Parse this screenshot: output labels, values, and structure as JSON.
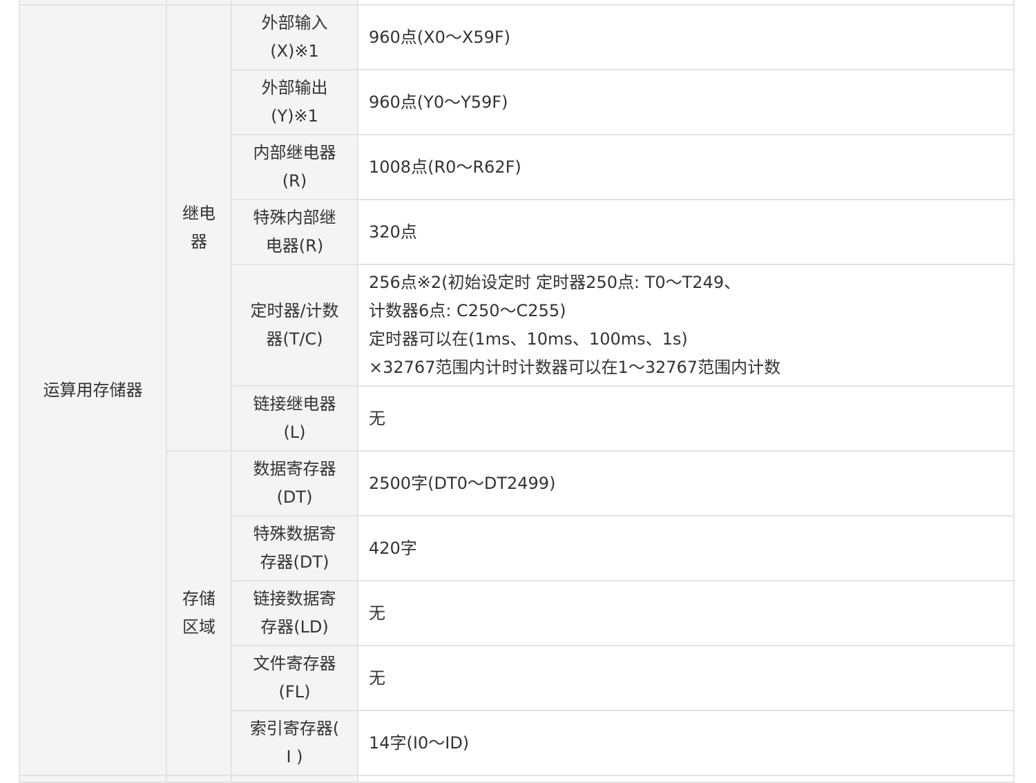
{
  "table": {
    "category": "运算用存储器",
    "groups": [
      {
        "label_lines": [
          "继电",
          "器"
        ],
        "rows": [
          {
            "name_lines": [
              "外部输入",
              "(X)※1"
            ],
            "value_lines": [
              "960点(X0～X59F)"
            ]
          },
          {
            "name_lines": [
              "外部输出",
              "(Y)※1"
            ],
            "value_lines": [
              "960点(Y0～Y59F)"
            ]
          },
          {
            "name_lines": [
              "内部继电器",
              "(R)"
            ],
            "value_lines": [
              "1008点(R0～R62F)"
            ]
          },
          {
            "name_lines": [
              "特殊内部继",
              "电器(R)"
            ],
            "value_lines": [
              "320点"
            ]
          },
          {
            "name_lines": [
              "定时器/计数",
              "器(T/C)"
            ],
            "value_lines": [
              "256点※2(初始设定时 定时器250点: T0～T249、",
              "计数器6点: C250～C255)",
              "定时器可以在(1ms、10ms、100ms、1s)",
              "×32767范围内计时计数器可以在1～32767范围内计数"
            ]
          },
          {
            "name_lines": [
              "链接继电器",
              "(L)"
            ],
            "value_lines": [
              "无"
            ]
          }
        ]
      },
      {
        "label_lines": [
          "存储",
          "区域"
        ],
        "rows": [
          {
            "name_lines": [
              "数据寄存器",
              "(DT)"
            ],
            "value_lines": [
              "2500字(DT0～DT2499)"
            ]
          },
          {
            "name_lines": [
              "特殊数据寄",
              "存器(DT)"
            ],
            "value_lines": [
              "420字"
            ]
          },
          {
            "name_lines": [
              "链接数据寄",
              "存器(LD)"
            ],
            "value_lines": [
              "无"
            ]
          },
          {
            "name_lines": [
              "文件寄存器",
              "(FL)"
            ],
            "value_lines": [
              "无"
            ]
          },
          {
            "name_lines": [
              "索引寄存器(",
              "I )"
            ],
            "value_lines": [
              "14字(I0～ID)"
            ]
          }
        ]
      }
    ]
  }
}
